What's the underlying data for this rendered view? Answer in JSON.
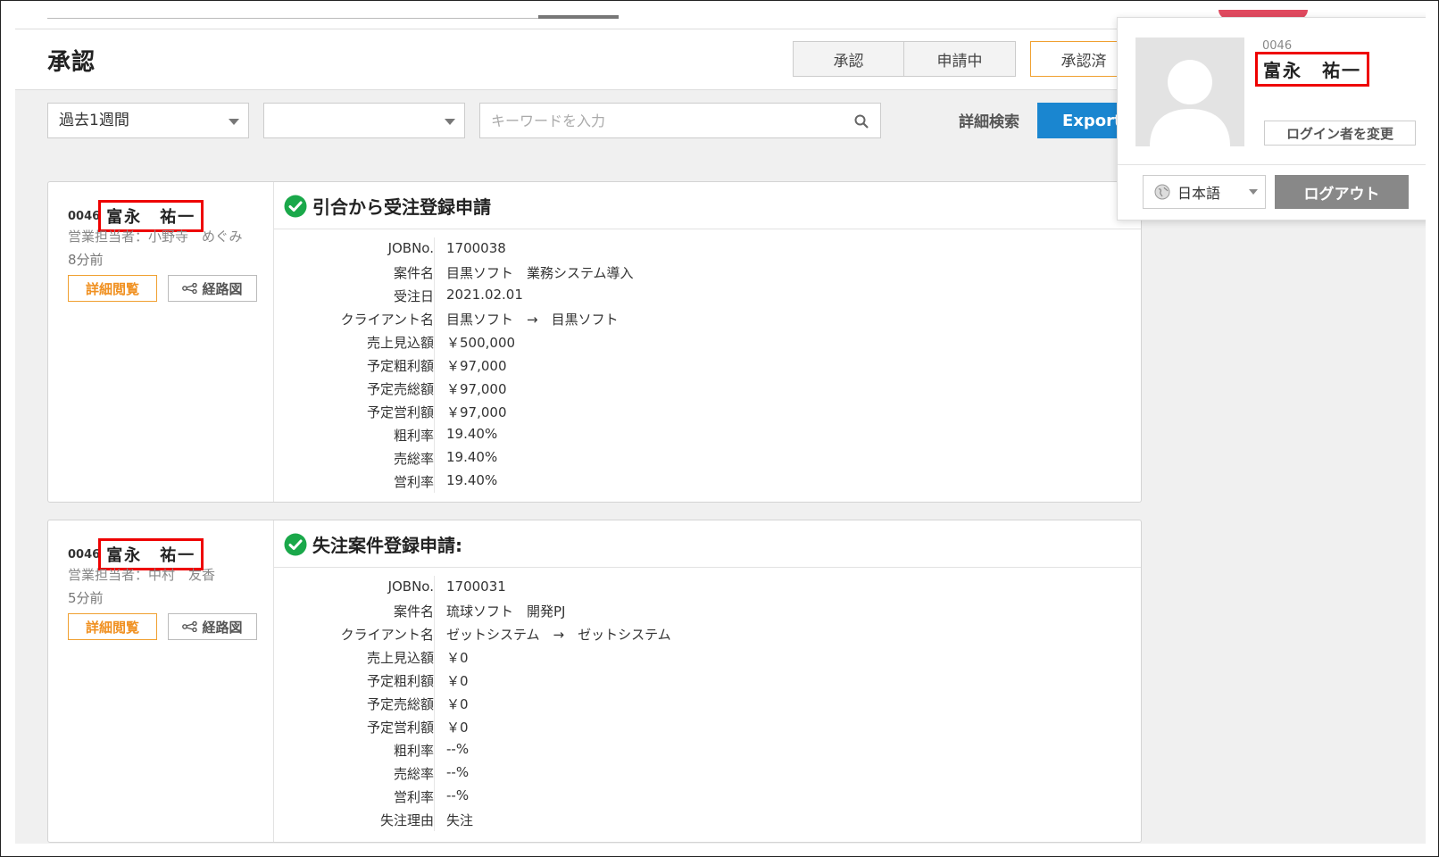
{
  "header": {
    "title": "承認",
    "tabs": [
      {
        "label": "承認"
      },
      {
        "label": "申請中"
      },
      {
        "label": "承認済"
      }
    ]
  },
  "filters": {
    "period": "過去1週間",
    "second_select": "",
    "search_placeholder": "キーワードを入力",
    "advanced_search": "詳細検索",
    "export_label": "Export"
  },
  "cards": [
    {
      "code": "0046",
      "name": "富永　祐一",
      "sales_rep": "営業担当者：小野寺　めぐみ",
      "time_ago": "8分前",
      "detail_button": "詳細閲覧",
      "route_button": "経路図",
      "title": "引合から受注登録申請",
      "rows": [
        {
          "k": "JOBNo.",
          "v": "1700038"
        },
        {
          "k": "案件名",
          "v": "目黒ソフト　業務システム導入"
        },
        {
          "k": "受注日",
          "v": "2021.02.01"
        },
        {
          "k": "クライアント名",
          "v": "目黒ソフト　→　目黒ソフト"
        },
        {
          "k": "売上見込額",
          "v": "￥500,000"
        },
        {
          "k": "予定粗利額",
          "v": "￥97,000"
        },
        {
          "k": "予定売総額",
          "v": "￥97,000"
        },
        {
          "k": "予定営利額",
          "v": "￥97,000"
        },
        {
          "k": "粗利率",
          "v": "19.40%"
        },
        {
          "k": "売総率",
          "v": "19.40%"
        },
        {
          "k": "営利率",
          "v": "19.40%"
        }
      ]
    },
    {
      "code": "0046",
      "name": "富永　祐一",
      "sales_rep": "営業担当者：中村　友香",
      "time_ago": "5分前",
      "detail_button": "詳細閲覧",
      "route_button": "経路図",
      "title": "失注案件登録申請:",
      "rows": [
        {
          "k": "JOBNo.",
          "v": "1700031"
        },
        {
          "k": "案件名",
          "v": "琉球ソフト　開発PJ"
        },
        {
          "k": "クライアント名",
          "v": "ゼットシステム　→　ゼットシステム"
        },
        {
          "k": "売上見込額",
          "v": "￥0"
        },
        {
          "k": "予定粗利額",
          "v": "￥0"
        },
        {
          "k": "予定売総額",
          "v": "￥0"
        },
        {
          "k": "予定営利額",
          "v": "￥0"
        },
        {
          "k": "粗利率",
          "v": "--%"
        },
        {
          "k": "売総率",
          "v": "--%"
        },
        {
          "k": "営利率",
          "v": "--%"
        },
        {
          "k": "失注理由",
          "v": "失注"
        }
      ]
    }
  ],
  "user_popover": {
    "code": "0046",
    "name": "富永　祐一",
    "change_login": "ログイン者を変更",
    "language": "日本語",
    "logout": "ログアウト"
  },
  "colors": {
    "accent_orange": "#f0a030",
    "export_blue": "#1a86d0",
    "highlight_red": "#e00000",
    "check_green": "#1aa84a"
  }
}
